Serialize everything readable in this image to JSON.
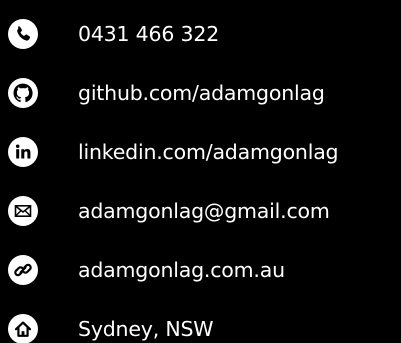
{
  "colors": {
    "background": "#000000",
    "icon_fill": "#ffffff",
    "icon_glyph": "#000000",
    "text": "#ffffff"
  },
  "contacts": [
    {
      "icon": "phone-icon",
      "text": "0431 466 322"
    },
    {
      "icon": "github-icon",
      "text": "github.com/adamgonlag"
    },
    {
      "icon": "linkedin-icon",
      "text": "linkedin.com/adamgonlag"
    },
    {
      "icon": "email-icon",
      "text": "adamgonlag@gmail.com"
    },
    {
      "icon": "link-icon",
      "text": "adamgonlag.com.au"
    },
    {
      "icon": "home-icon",
      "text": "Sydney, NSW"
    }
  ]
}
